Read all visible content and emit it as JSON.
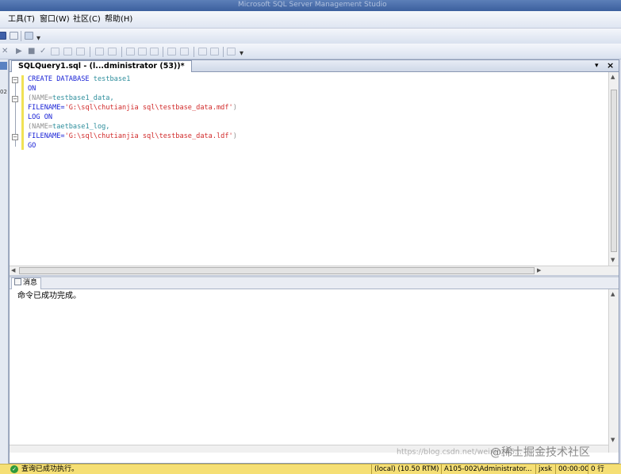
{
  "window": {
    "title": "Microsoft SQL Server Management Studio"
  },
  "menubar": {
    "items": [
      {
        "label": "工具(T)"
      },
      {
        "label": "窗口(W)"
      },
      {
        "label": "社区(C)"
      },
      {
        "label": "帮助(H)"
      }
    ]
  },
  "left_panel": {
    "clipped_text": "02"
  },
  "document_tab": {
    "label": "SQLQuery1.sql - (l...dministrator (53))*",
    "dropdown_glyph": "▾",
    "close_glyph": "×"
  },
  "editor": {
    "lines": [
      {
        "segments": [
          {
            "text": "CREATE DATABASE ",
            "kind": "kw"
          },
          {
            "text": "testbase1",
            "kind": "pl"
          }
        ]
      },
      {
        "segments": [
          {
            "text": "ON",
            "kind": "kw"
          }
        ]
      },
      {
        "segments": [
          {
            "text": "(NAME=",
            "kind": "gray"
          },
          {
            "text": "testbase1_data,",
            "kind": "pl"
          }
        ]
      },
      {
        "segments": [
          {
            "text": "FILENAME=",
            "kind": "kw"
          },
          {
            "text": "'G:\\sql\\chutianjia sql\\testbase_data.mdf'",
            "kind": "str"
          },
          {
            "text": ")",
            "kind": "gray"
          }
        ]
      },
      {
        "segments": [
          {
            "text": "LOG ON",
            "kind": "kw"
          }
        ]
      },
      {
        "segments": [
          {
            "text": "(NAME=",
            "kind": "gray"
          },
          {
            "text": "taetbase1_log,",
            "kind": "pl"
          }
        ]
      },
      {
        "segments": [
          {
            "text": "FILENAME=",
            "kind": "kw"
          },
          {
            "text": "'G:\\sql\\chutianjia sql\\testbase_data.ldf'",
            "kind": "str"
          },
          {
            "text": ")",
            "kind": "gray"
          }
        ]
      },
      {
        "segments": [
          {
            "text": "GO",
            "kind": "kw"
          }
        ]
      }
    ]
  },
  "results": {
    "tab_label": "消息",
    "message": "命令已成功完成。"
  },
  "statusbar": {
    "text": "查询已成功执行。",
    "server": "(local) (10.50 RTM)",
    "login": "A105-002\\Administrator...",
    "database": "jxsk",
    "elapsed": "00:00:00",
    "rows": "0 行"
  },
  "watermark": {
    "url": "https://blog.csdn.net/weixin_45...",
    "brand": "@稀土掘金技术社区"
  },
  "colors": {
    "keyword": "#1a23d6",
    "string": "#d12a2a",
    "identifier": "#2e8e9c",
    "status_bar": "#f5df75",
    "change_marker": "#f0e154"
  }
}
